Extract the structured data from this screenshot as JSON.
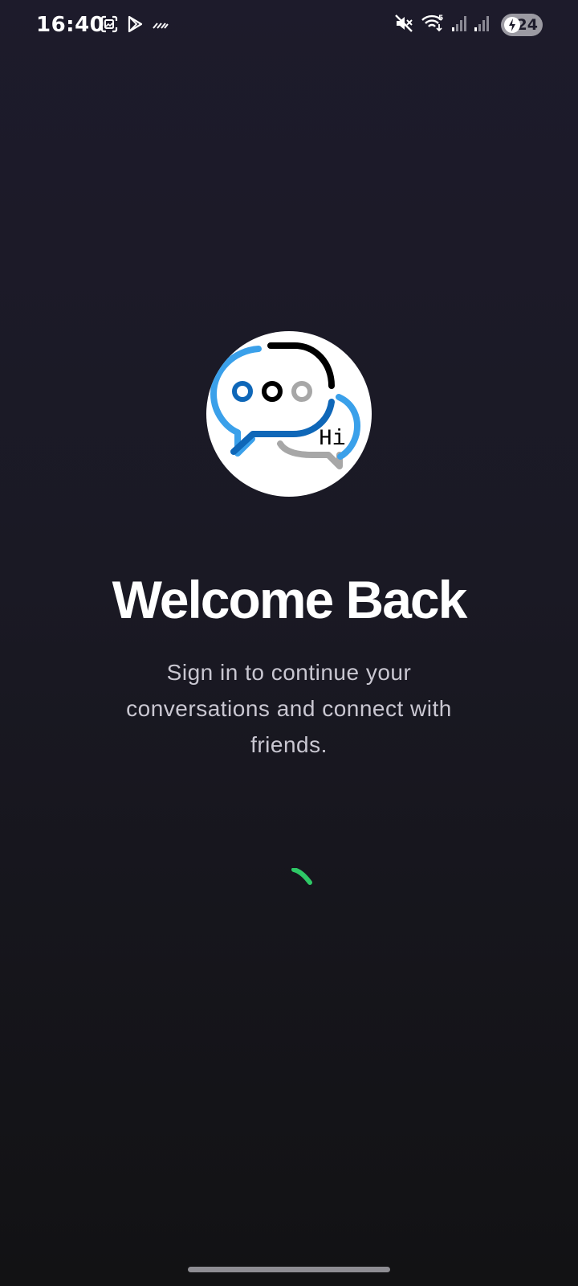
{
  "status_bar": {
    "time": "16:40",
    "battery_level": "24",
    "left_icons": [
      "screenshot-icon",
      "play-store-icon",
      "data-saver-icon"
    ],
    "right_icons": [
      "mute-icon",
      "wifi-icon",
      "signal-icon",
      "signal-icon"
    ]
  },
  "logo": {
    "text": "Hi",
    "colors": {
      "light_blue": "#3aa0ea",
      "dark_blue": "#0f67b8",
      "black": "#000000",
      "gray": "#a7a7a7"
    }
  },
  "welcome": {
    "title": "Welcome Back",
    "subtitle": "Sign in to continue your conversations and connect with friends."
  },
  "spinner": {
    "color": "#2ec866"
  },
  "colors": {
    "background_top": "#1d1b2b",
    "background_bottom": "#121214",
    "subtitle": "#c9c7d1"
  }
}
